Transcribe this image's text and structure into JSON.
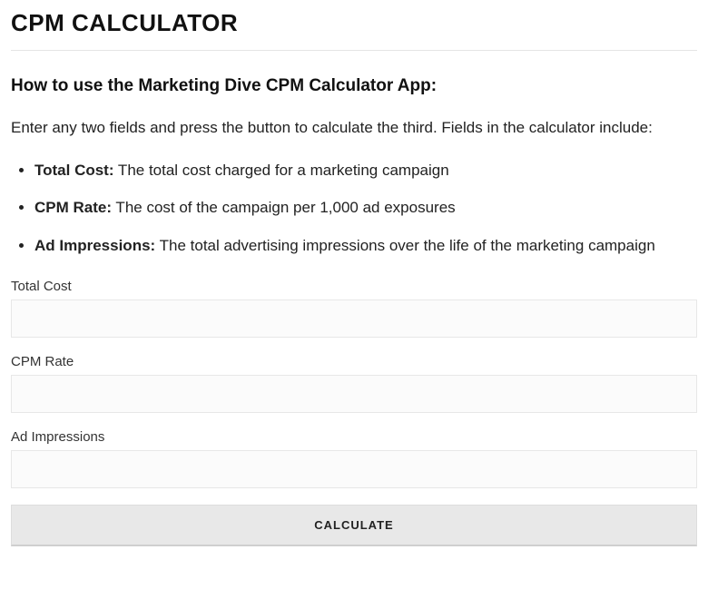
{
  "header": {
    "title": "CPM CALCULATOR"
  },
  "intro": {
    "subtitle": "How to use the Marketing Dive CPM Calculator App:",
    "text": "Enter any two fields and press the button to calculate the third.  Fields in the calculator include:"
  },
  "definitions": [
    {
      "term": "Total Cost:",
      "desc": " The total cost charged for a marketing campaign"
    },
    {
      "term": "CPM Rate:",
      "desc": " The cost of the campaign per 1,000 ad exposures"
    },
    {
      "term": "Ad Impressions:",
      "desc": " The total advertising impressions over the life of the marketing campaign"
    }
  ],
  "form": {
    "total_cost": {
      "label": "Total Cost",
      "value": ""
    },
    "cpm_rate": {
      "label": "CPM Rate",
      "value": ""
    },
    "ad_impressions": {
      "label": "Ad Impressions",
      "value": ""
    },
    "button_label": "CALCULATE"
  }
}
